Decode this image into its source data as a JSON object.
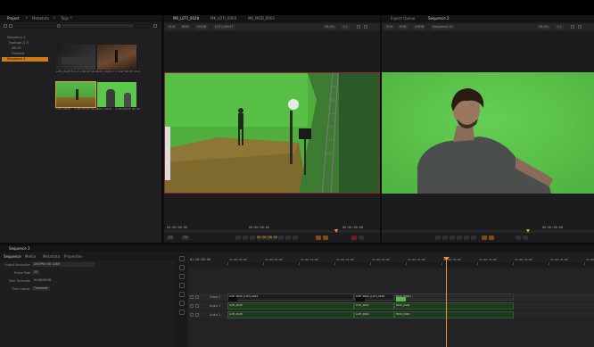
{
  "project_panel": {
    "tabs": [
      "Project",
      "Metadata",
      "Tags"
    ],
    "tree": [
      "Sequence 2",
      "Footage (17)",
      "MK-05",
      "Finished",
      "Sequence 2"
    ],
    "selected_index": 4,
    "thumbs": [
      {
        "caption": "LOTI_0028\nfull_2 1 NK 00:14:23 17"
      },
      {
        "caption": "LOTI_0028 2 1 HALF NK 00:14:25 13"
      },
      {
        "caption": "LOTI_0028 ... 2 MK MOVE NK 00:14:08 16"
      },
      {
        "caption": "LOTI_0028 ... 2 MK MOVE NK 00:14:08 16"
      }
    ]
  },
  "viewer_left": {
    "tabs": [
      "MK_LOTI_0028",
      "MK_LOTI_0004",
      "MK_MOD_0003"
    ],
    "toolbar": [
      "YUV",
      "RGB",
      "UHDB",
      "LOTI_0004T",
      "38.0%",
      "1:1"
    ],
    "timecode_left": "00:00:00:00",
    "timecode_mid": "00:00:00:00",
    "timecode_right": "00:00:00:00",
    "fps": "25",
    "zoom": "Fit"
  },
  "viewer_right": {
    "tabs": [
      "Export Queue",
      "Sequence 2"
    ],
    "toolbar": [
      "YUV",
      "RGB",
      "UHDB",
      "Sequence 2T",
      "38.0%",
      "1:1"
    ],
    "timecode": "00:00:00:00"
  },
  "sequence_panel": {
    "title": "Sequence 2",
    "tabs": [
      "Sequence",
      "Media",
      "Metadata",
      "Properties"
    ],
    "properties": [
      {
        "label": "Output Resolution",
        "value": "DVCPRO HD 1080i"
      },
      {
        "label": "Frame Rate",
        "value": "25"
      },
      {
        "label": "Start Timecode",
        "value": "01:00:00:00"
      },
      {
        "label": "Time Display",
        "value": "Timecode"
      }
    ]
  },
  "timeline": {
    "start_tc": "01:00:00:00",
    "ruler_marks": [
      "01:00:00:00",
      "01:00:05:00",
      "01:00:10:00",
      "01:00:15:00",
      "01:00:20:00",
      "01:00:25:00",
      "01:00:30:00",
      "01:00:35:00",
      "01:00:40:00",
      "01:00:45:00",
      "01:00:50:00"
    ],
    "tracks": [
      "Video 1",
      "Audio 1",
      "Audio 2"
    ],
    "clips": [
      {
        "track": 0,
        "label": "LOTI_0028 | LOTI_0004",
        "color": "#3a6a2a"
      },
      {
        "track": 0,
        "label": "LOTI_0004 | LOTI_0028",
        "color": "#3a6a2a"
      },
      {
        "track": 0,
        "label": "MOD_0004 | ...",
        "color": "#58b84a"
      },
      {
        "track": 1,
        "label": "LOTI_0028",
        "color": "#224a22"
      },
      {
        "track": 1,
        "label": "LOTI_0004",
        "color": "#224a22"
      },
      {
        "track": 1,
        "label": "MOD_0004",
        "color": "#224a22"
      },
      {
        "track": 2,
        "label": "LOTI_0028",
        "color": "#224a22"
      },
      {
        "track": 2,
        "label": "LOTI_0004",
        "color": "#224a22"
      },
      {
        "track": 2,
        "label": "MOD_0004",
        "color": "#224a22"
      }
    ]
  },
  "colors": {
    "accent": "#e89c2a",
    "green_screen": "#5cc74a",
    "selection": "#d07a18"
  }
}
